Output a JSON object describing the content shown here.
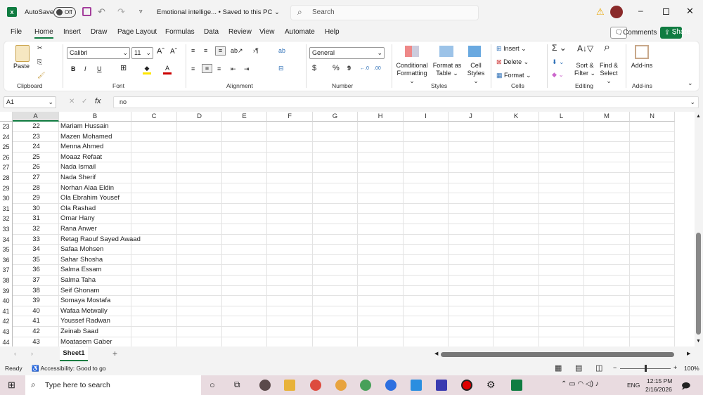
{
  "title": {
    "autosave": "AutoSave",
    "toggle": "Off",
    "doc": "Emotional intellige... • Saved to this PC ⌄",
    "search": "Search"
  },
  "menu": [
    "File",
    "Home",
    "Insert",
    "Draw",
    "Page Layout",
    "Formulas",
    "Data",
    "Review",
    "View",
    "Automate",
    "Help"
  ],
  "buttons": {
    "comments": "Comments",
    "share": "Share"
  },
  "ribbon": {
    "paste": "Paste",
    "font": "Calibri",
    "size": "11",
    "number_format": "General",
    "conditional": "Conditional",
    "formatting": "Formatting ⌄",
    "format_as": "Format as",
    "table": "Table ⌄",
    "cell": "Cell",
    "styles": "Styles ⌄",
    "insert": "Insert",
    "delete": "Delete",
    "format": "Format ⌄",
    "sort": "Sort &",
    "filter": "Filter ⌄",
    "find": "Find &",
    "select": "Select ⌄",
    "addins": "Add-ins",
    "groups": {
      "clipboard": "Clipboard",
      "font": "Font",
      "alignment": "Alignment",
      "number": "Number",
      "styles": "Styles",
      "cells": "Cells",
      "editing": "Editing",
      "addins": "Add-ins"
    }
  },
  "formula": {
    "namebox": "A1",
    "fx": "fx",
    "value": "no"
  },
  "columns": [
    "A",
    "B",
    "C",
    "D",
    "E",
    "F",
    "G",
    "H",
    "I",
    "J",
    "K",
    "L",
    "M",
    "N"
  ],
  "rows": [
    [
      "23",
      "22",
      "Mariam Hussain"
    ],
    [
      "24",
      "23",
      "Mazen Mohamed"
    ],
    [
      "25",
      "24",
      "Menna Ahmed"
    ],
    [
      "26",
      "25",
      "Moaaz Refaat"
    ],
    [
      "27",
      "26",
      "Nada Ismail"
    ],
    [
      "28",
      "27",
      "Nada Sherif"
    ],
    [
      "29",
      "28",
      "Norhan Alaa Eldin"
    ],
    [
      "30",
      "29",
      "Ola Ebrahim Yousef"
    ],
    [
      "31",
      "30",
      "Ola Rashad"
    ],
    [
      "32",
      "31",
      "Omar Hany"
    ],
    [
      "33",
      "32",
      "Rana Anwer"
    ],
    [
      "34",
      "33",
      "Retag Raouf Sayed Awaad"
    ],
    [
      "35",
      "34",
      "Safaa Mohsen"
    ],
    [
      "36",
      "35",
      "Sahar Shosha"
    ],
    [
      "37",
      "36",
      "Salma Essam"
    ],
    [
      "38",
      "37",
      "Salma Taha"
    ],
    [
      "39",
      "38",
      "Seif Ghonam"
    ],
    [
      "40",
      "39",
      "Somaya Mostafa"
    ],
    [
      "41",
      "40",
      "Wafaa Metwally"
    ],
    [
      "42",
      "41",
      "Youssef Radwan"
    ],
    [
      "43",
      "42",
      "Zeinab Saad"
    ],
    [
      "44",
      "43",
      "Moatasem Gaber"
    ]
  ],
  "sheet": {
    "tab": "Sheet1",
    "add": "+"
  },
  "status": {
    "ready": "Ready",
    "accessibility": "Accessibility: Good to go",
    "zoom": "100%"
  },
  "taskbar": {
    "search": "Type here to search",
    "lang": "ENG",
    "time": "12:15 PM",
    "date": "2/16/2026"
  },
  "colors": {
    "accent": "#107c41"
  }
}
